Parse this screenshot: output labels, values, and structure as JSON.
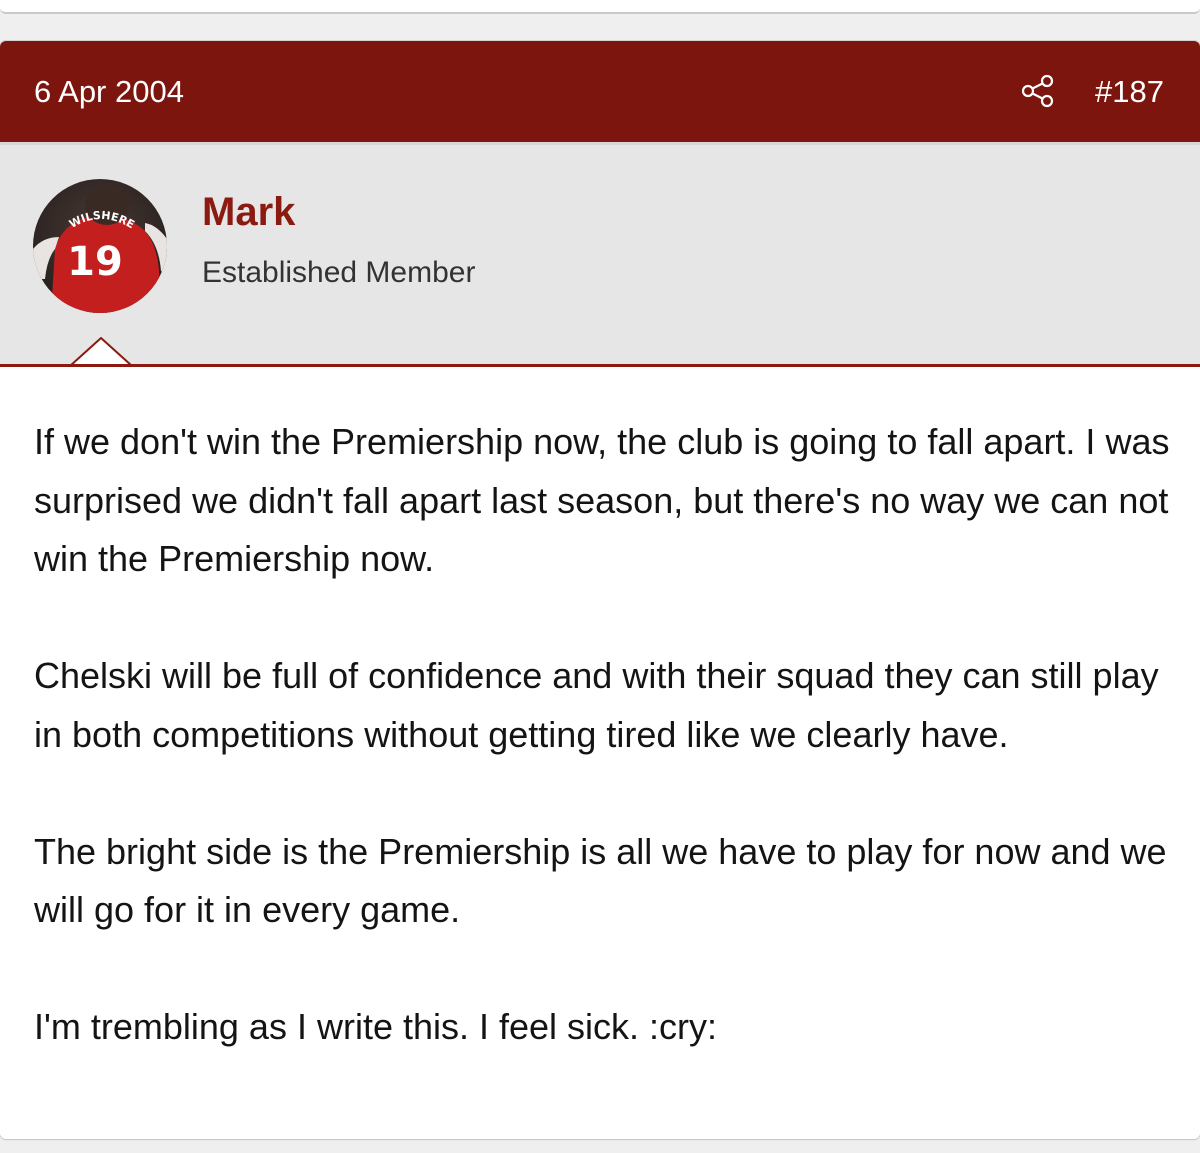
{
  "post": {
    "date": "6 Apr 2004",
    "number": "#187",
    "share_icon": "share-icon",
    "accent_color": "#7b150d"
  },
  "user": {
    "name": "Mark",
    "title": "Established Member",
    "avatar": {
      "jersey_name": "WILSHERE",
      "jersey_number": "19"
    }
  },
  "body": {
    "paragraphs": [
      "If we don't win the Premiership now, the club is going to fall apart. I was surprised we didn't fall apart last season, but there's no way we can not win the Premiership now.",
      "Chelski will be full of confidence and with their squad they can still play in both competitions without getting tired like we clearly have.",
      "The bright side is the Premiership is all we have to play for now and we will go for it in every game.",
      "I'm trembling as I write this. I feel sick. :cry:"
    ]
  }
}
